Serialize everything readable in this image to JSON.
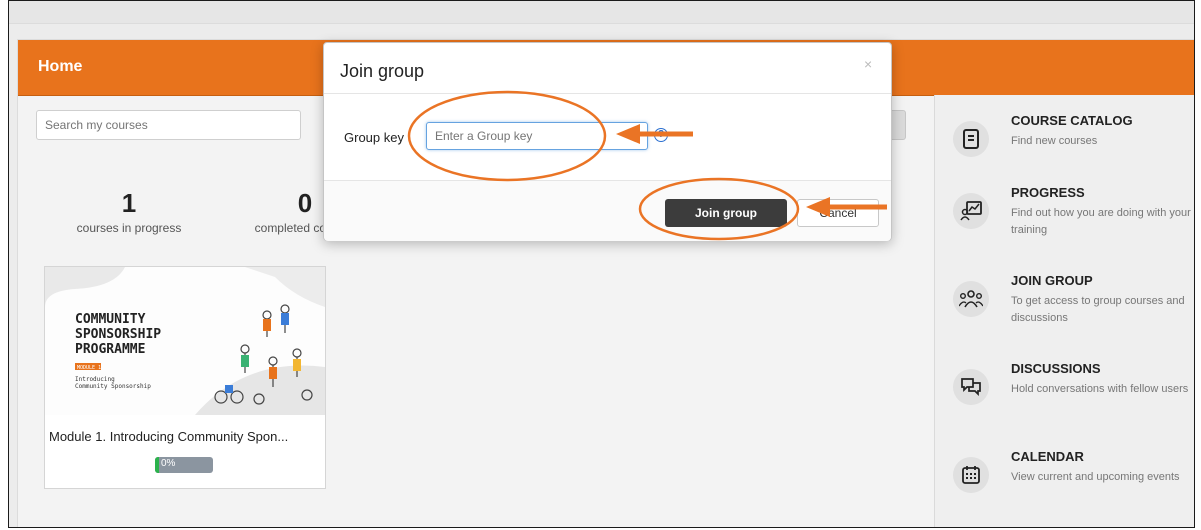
{
  "header": {
    "title": "Home"
  },
  "search": {
    "placeholder": "Search my courses"
  },
  "stats": [
    {
      "value": "1",
      "label": "courses in progress"
    },
    {
      "value": "0",
      "label": "completed courses"
    }
  ],
  "course_card": {
    "image_text": [
      "COMMUNITY",
      "SPONSORSHIP",
      "PROGRAMME"
    ],
    "module_tag": "MODULE 1",
    "module_subtitle": [
      "Introducing",
      "Community Sponsorship"
    ],
    "name": "Module 1. Introducing Community Spon...",
    "progress_text": "0%",
    "progress": 0
  },
  "sidebar": {
    "items": [
      {
        "title": "COURSE CATALOG",
        "desc": "Find new courses",
        "icon": "book-icon"
      },
      {
        "title": "PROGRESS",
        "desc": "Find out how you are doing with your training",
        "icon": "progress-chart-icon"
      },
      {
        "title": "JOIN GROUP",
        "desc": "To get access to group courses and discussions",
        "icon": "group-icon"
      },
      {
        "title": "DISCUSSIONS",
        "desc": "Hold conversations with fellow users",
        "icon": "chat-icon"
      },
      {
        "title": "CALENDAR",
        "desc": "View current and upcoming events",
        "icon": "calendar-icon"
      }
    ]
  },
  "modal": {
    "title": "Join group",
    "close": "×",
    "group_key_label": "Group key",
    "group_key_placeholder": "Enter a Group key",
    "info": "?",
    "join_button": "Join group",
    "cancel_button": "Cancel"
  },
  "colors": {
    "header": "#e8731c",
    "annotation": "#ea7425",
    "join_button": "#3c3c3c",
    "progress_fill": "#2bb24c"
  }
}
